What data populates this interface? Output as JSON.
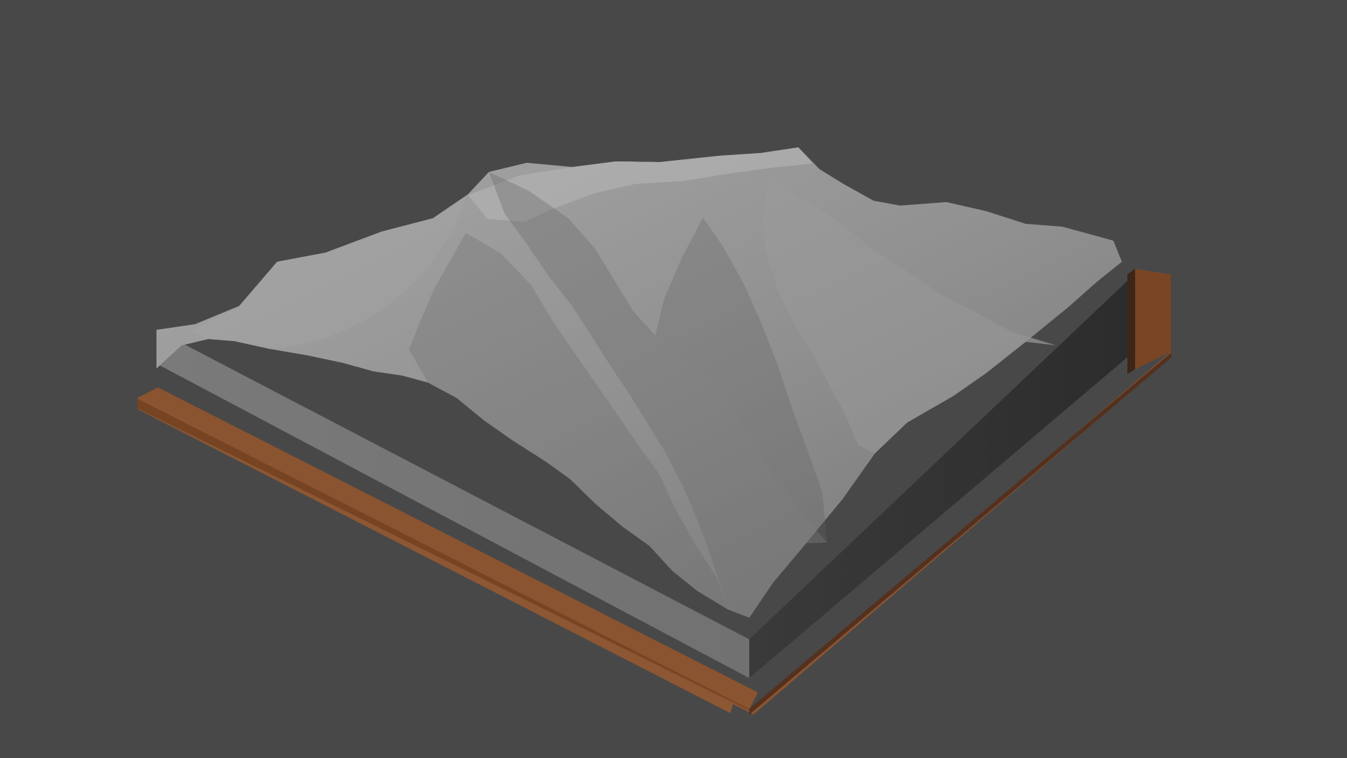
{
  "viewport": {
    "background_color": "#484848"
  },
  "model": {
    "terrain_color": "#8c8c8c",
    "terrain_highlight_color": "#a9a9a9",
    "terrain_shadow_color": "#5b5b5b",
    "base_side_color": "#7a7a7a",
    "base_dark_side_color": "#2f2f2f",
    "frame_color": "#7a4726",
    "frame_dark_color": "#3a2418",
    "frame_shadow_color": "#2d1b12"
  }
}
